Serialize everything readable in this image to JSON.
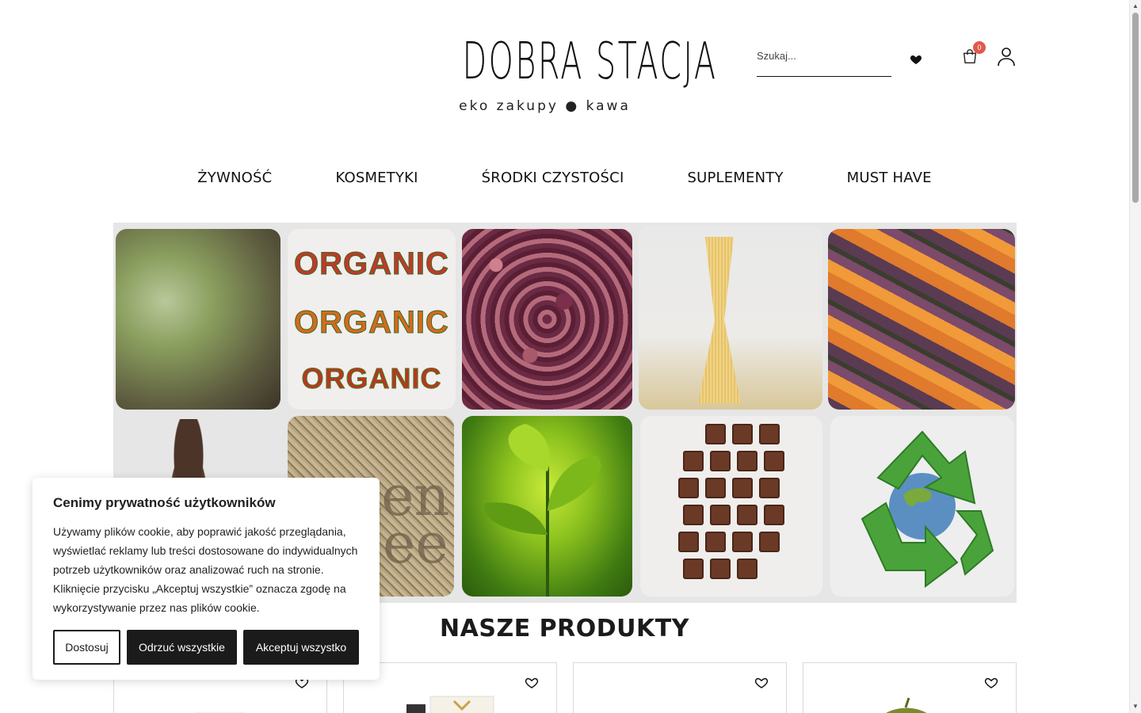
{
  "header": {
    "logo_title": "DOBRA STACJA",
    "logo_subtitle": "eko zakupy ● kawa",
    "search_placeholder": "Szukaj...",
    "cart_count": "0"
  },
  "nav": {
    "items": [
      "ŻYWNOŚĆ",
      "KOSMETYKI",
      "ŚRODKI CZYSTOŚCI",
      "SUPLEMENTY",
      "MUST HAVE"
    ]
  },
  "banner": {
    "organic_words": [
      "ORGANIC",
      "ORGANIC",
      "ORGANIC"
    ],
    "seed_text": [
      "ten",
      "ee"
    ]
  },
  "products": {
    "section_title": "NASZE PRODUKTY"
  },
  "cookie": {
    "title": "Cenimy prywatność użytkowników",
    "text": "Używamy plików cookie, aby poprawić jakość przeglądania, wyświetlać reklamy lub treści dostosowane do indywidualnych potrzeb użytkowników oraz analizować ruch na stronie. Kliknięcie przycisku „Akceptuj wszystkie” oznacza zgodę na wykorzystywanie przez nas plików cookie.",
    "customize_label": "Dostosuj",
    "reject_label": "Odrzuć wszystkie",
    "accept_label": "Akceptuj wszystko"
  },
  "colors": {
    "accent_dark": "#1b1b1b",
    "badge": "#e05a4d"
  }
}
